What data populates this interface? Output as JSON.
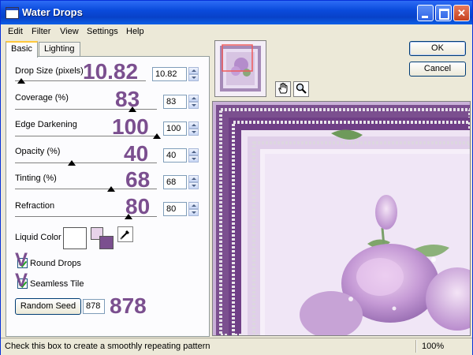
{
  "window": {
    "title": "Water Drops"
  },
  "menu": [
    "Edit",
    "Filter",
    "View",
    "Settings",
    "Help"
  ],
  "tabs": [
    "Basic",
    "Lighting"
  ],
  "params": [
    {
      "label": "Drop Size (pixels)",
      "value": "10.82",
      "big": "10.82",
      "fraction": 0.05
    },
    {
      "label": "Coverage (%)",
      "value": "83",
      "big": "83",
      "fraction": 0.83
    },
    {
      "label": "Edge Darkening",
      "value": "100",
      "big": "100",
      "fraction": 1.0
    },
    {
      "label": "Opacity (%)",
      "value": "40",
      "big": "40",
      "fraction": 0.4
    },
    {
      "label": "Tinting (%)",
      "value": "68",
      "big": "68",
      "fraction": 0.68
    },
    {
      "label": "Refraction",
      "value": "80",
      "big": "80",
      "fraction": 0.8
    }
  ],
  "liquid_color": {
    "label": "Liquid Color",
    "main": "#ffffff",
    "fg": "#e8d3ea",
    "bg": "#7b4f8f"
  },
  "checkboxes": [
    {
      "label": "Round Drops",
      "mark": "V",
      "checked": true
    },
    {
      "label": "Seamless Tile",
      "mark": "V",
      "checked": true
    }
  ],
  "random_seed": {
    "button": "Random Seed",
    "value": "878",
    "big": "878"
  },
  "buttons": {
    "ok": "OK",
    "cancel": "Cancel"
  },
  "status": {
    "text": "Check this box to create a smoothly repeating pattern",
    "zoom": "100%"
  },
  "icons": {
    "pan": "hand-icon",
    "zoom": "magnifier-icon",
    "eyedropper": "eyedropper-icon"
  }
}
